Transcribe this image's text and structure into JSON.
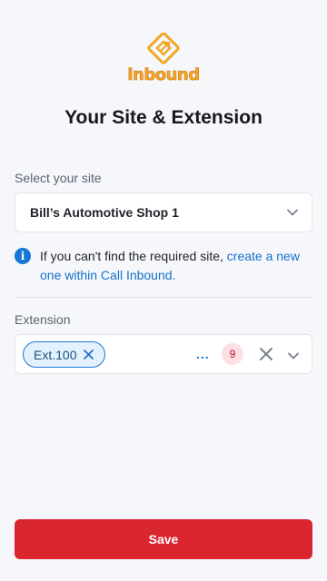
{
  "brand": {
    "logo_text": "inbound",
    "accent_color": "#f5a623"
  },
  "page": {
    "title": "Your Site & Extension"
  },
  "site": {
    "label": "Select your site",
    "selected": "Bill’s Automotive Shop 1",
    "dropdown_icon": "chevron-down-icon"
  },
  "info": {
    "icon": "info-icon",
    "text": "If you can't find the required site,",
    "link_text": "create a new one within Call Inbound."
  },
  "extension": {
    "label": "Extension",
    "chips": [
      {
        "label": "Ext.100"
      }
    ],
    "more_indicator": "...",
    "count": "9",
    "clear_icon": "close-icon",
    "dropdown_icon": "chevron-down-icon"
  },
  "actions": {
    "save_label": "Save",
    "save_color": "#d9262f"
  }
}
